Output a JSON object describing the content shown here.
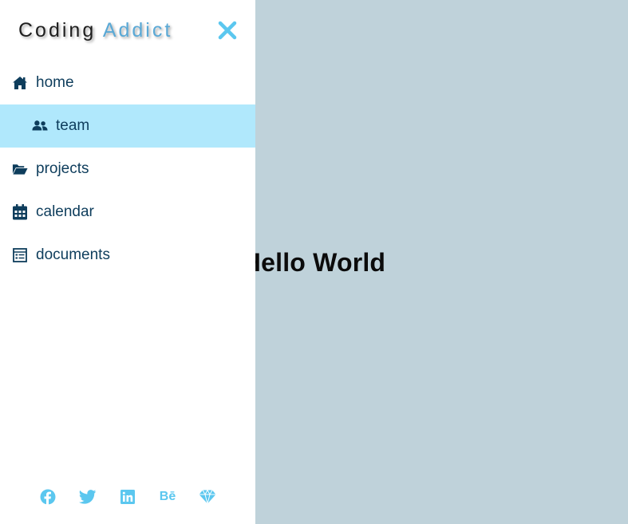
{
  "main": {
    "heading": "Hello World",
    "background_color": "#bfd2da"
  },
  "sidebar": {
    "logo": {
      "part1": "Coding",
      "part2": "Addict"
    },
    "close_icon": "close-icon",
    "items": [
      {
        "label": "home",
        "icon": "home-icon",
        "active": false
      },
      {
        "label": "team",
        "icon": "users-icon",
        "active": true
      },
      {
        "label": "projects",
        "icon": "folder-open-icon",
        "active": false
      },
      {
        "label": "calendar",
        "icon": "calendar-icon",
        "active": false
      },
      {
        "label": "documents",
        "icon": "document-icon",
        "active": false
      }
    ],
    "social_links": [
      {
        "icon": "facebook-icon"
      },
      {
        "icon": "twitter-icon"
      },
      {
        "icon": "linkedin-icon"
      },
      {
        "icon": "behance-icon",
        "text": "Bē"
      },
      {
        "icon": "sketch-icon"
      }
    ]
  },
  "colors": {
    "accent": "#5bc7ef",
    "active_bg": "#b0e8fc",
    "nav_text": "#0e3d5c",
    "logo_accent": "#5aa9d6"
  }
}
